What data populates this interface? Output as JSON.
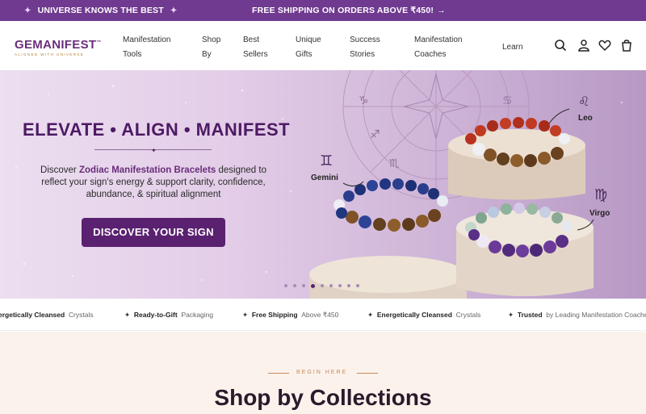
{
  "announcement": {
    "left": "UNIVERSE KNOWS THE BEST",
    "center": "FREE SHIPPING ON ORDERS ABOVE ₹450!",
    "arrow": "→"
  },
  "brand": {
    "name": "GEMANIFEST",
    "tm": "™",
    "tagline": "ALIGNED WITH UNIVERSE"
  },
  "nav": [
    {
      "line1": "Manifestation",
      "line2": "Tools"
    },
    {
      "line1": "Shop",
      "line2": "By"
    },
    {
      "line1": "Best",
      "line2": "Sellers"
    },
    {
      "line1": "Unique",
      "line2": "Gifts"
    },
    {
      "line1": "Success",
      "line2": "Stories"
    },
    {
      "line1": "Manifestation",
      "line2": "Coaches"
    },
    {
      "line1": "Learn",
      "line2": ""
    }
  ],
  "header_icons": [
    "search-icon",
    "account-icon",
    "wishlist-icon",
    "cart-icon"
  ],
  "hero": {
    "title": "ELEVATE • ALIGN • MANIFEST",
    "desc_prefix": "Discover ",
    "desc_highlight": "Zodiac Manifestation Bracelets",
    "desc_suffix": " designed to reflect your sign's energy & support clarity, confidence, abundance, & spiritual alignment",
    "cta": "DISCOVER YOUR SIGN",
    "signs": {
      "gemini": "Gemini",
      "leo": "Leo",
      "virgo": "Virgo"
    },
    "slides": 9,
    "active_slide": 3
  },
  "marquee": [
    {
      "bold": "ergetically Cleansed",
      "light": "Crystals"
    },
    {
      "bold": "Ready-to-Gift",
      "light": "Packaging"
    },
    {
      "bold": "Free Shipping",
      "light": "Above ₹450"
    },
    {
      "bold": "Energetically Cleansed",
      "light": "Crystals"
    },
    {
      "bold": "Trusted",
      "light": "by Leading Manifestation Coaches"
    }
  ],
  "collections": {
    "eyebrow": "BEGIN HERE",
    "title": "Shop by Collections"
  },
  "colors": {
    "brand_purple": "#6f3a8f",
    "cta": "#5a2170",
    "accent_gold": "#c98a57"
  }
}
